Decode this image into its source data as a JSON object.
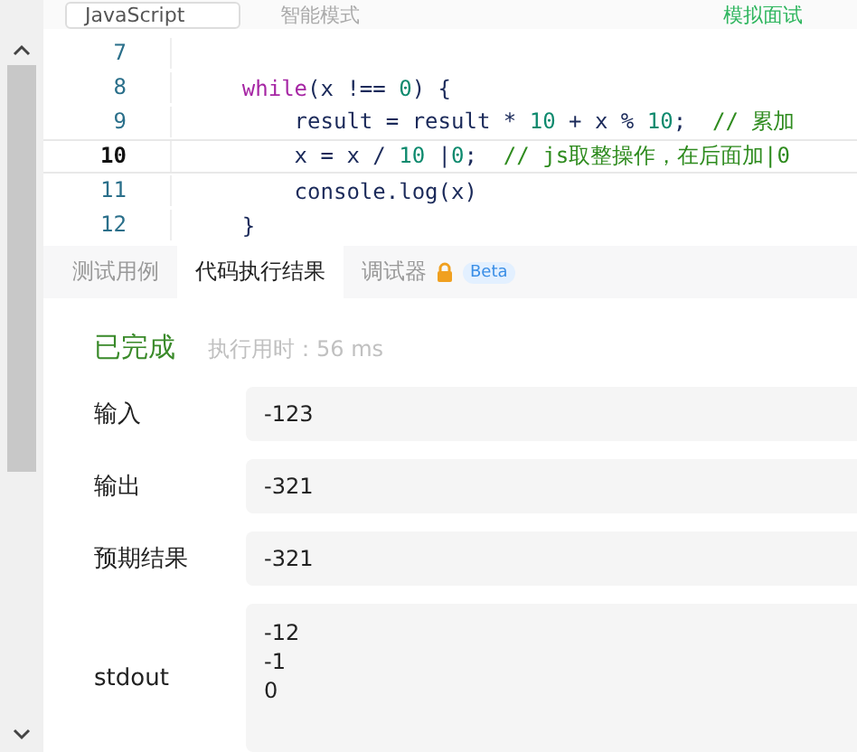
{
  "toolbar": {
    "language": "JavaScript",
    "mode": "智能模式",
    "interview": "模拟面试"
  },
  "code_lines": [
    {
      "number": "7",
      "current": false
    },
    {
      "number": "8",
      "current": false,
      "tokens": [
        {
          "text": "    while",
          "kind": "keyword"
        },
        {
          "text": "(x !== ",
          "kind": "plain"
        },
        {
          "text": "0",
          "kind": "number"
        },
        {
          "text": ") {",
          "kind": "plain"
        }
      ]
    },
    {
      "number": "9",
      "current": false,
      "tokens": [
        {
          "text": "        result = result * ",
          "kind": "plain"
        },
        {
          "text": "10",
          "kind": "number"
        },
        {
          "text": " + x % ",
          "kind": "plain"
        },
        {
          "text": "10",
          "kind": "number"
        },
        {
          "text": ";  ",
          "kind": "plain"
        },
        {
          "text": "// 累加",
          "kind": "comment"
        }
      ]
    },
    {
      "number": "10",
      "current": true,
      "tokens": [
        {
          "text": "        x = x / ",
          "kind": "plain"
        },
        {
          "text": "10",
          "kind": "number"
        },
        {
          "text": " |",
          "kind": "plain"
        },
        {
          "text": "0",
          "kind": "number"
        },
        {
          "text": ";  ",
          "kind": "plain"
        },
        {
          "text": "// js取整操作，在后面加|0",
          "kind": "comment"
        }
      ]
    },
    {
      "number": "11",
      "current": false,
      "tokens": [
        {
          "text": "        console.log(x)",
          "kind": "plain"
        }
      ]
    },
    {
      "number": "12",
      "current": false,
      "tokens": [
        {
          "text": "    }",
          "kind": "plain"
        }
      ]
    }
  ],
  "tabs": [
    {
      "label": "测试用例",
      "selected": false
    },
    {
      "label": "代码执行结果",
      "selected": true
    },
    {
      "label": "调试器",
      "selected": false,
      "locked": true,
      "badge": "Beta"
    }
  ],
  "result": {
    "status": "已完成",
    "time": "执行用时：56 ms"
  },
  "fields": [
    {
      "label": "输入",
      "lines": [
        "-123"
      ]
    },
    {
      "label": "输出",
      "lines": [
        "-321"
      ]
    },
    {
      "label": "预期结果",
      "lines": [
        "-321"
      ]
    },
    {
      "label": "stdout",
      "lines": [
        "-12",
        "-1",
        "0"
      ]
    }
  ]
}
